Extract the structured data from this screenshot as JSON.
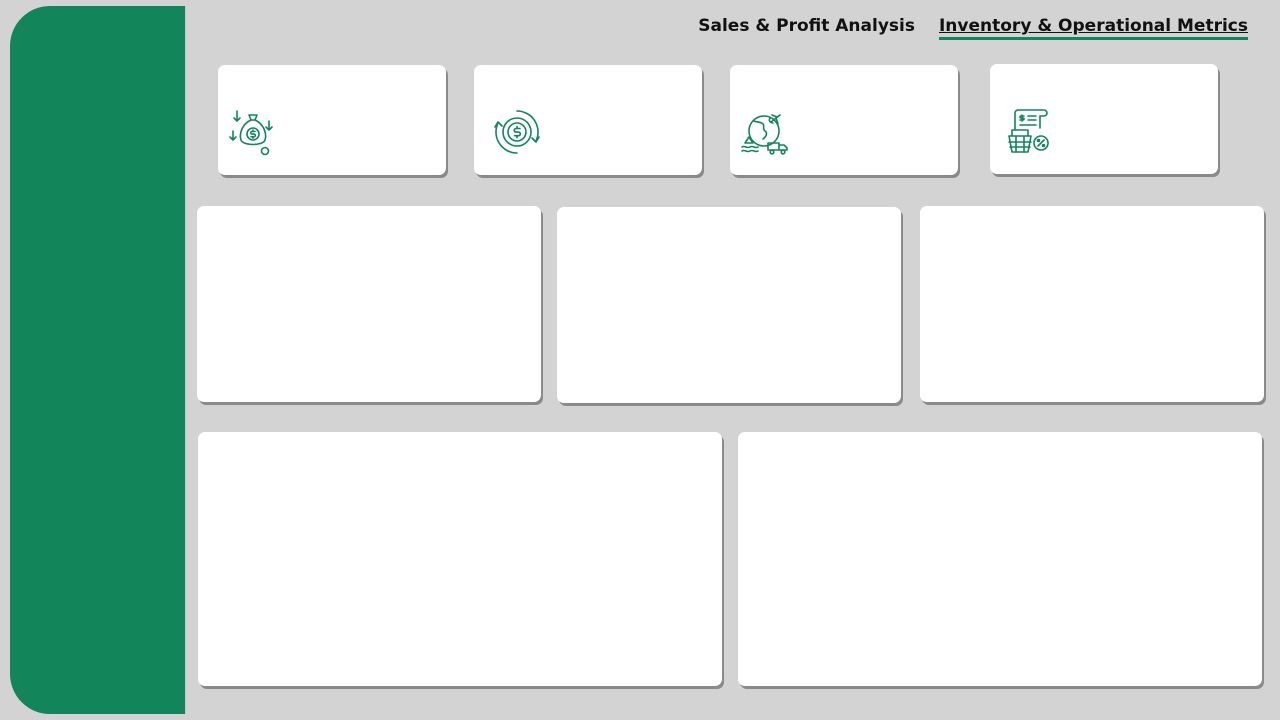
{
  "nav": {
    "tabs": [
      {
        "label": "Sales & Profit Analysis",
        "active": false
      },
      {
        "label": "Inventory & Operational Metrics",
        "active": true
      }
    ]
  },
  "kpi_cards": [
    {
      "icon": "money-bag-down-arrows-icon"
    },
    {
      "icon": "dollar-cycle-icon"
    },
    {
      "icon": "global-shipping-icon"
    },
    {
      "icon": "invoice-discount-icon"
    }
  ],
  "colors": {
    "accent": "#12855a",
    "background": "#d3d3d3",
    "card": "#ffffff"
  }
}
